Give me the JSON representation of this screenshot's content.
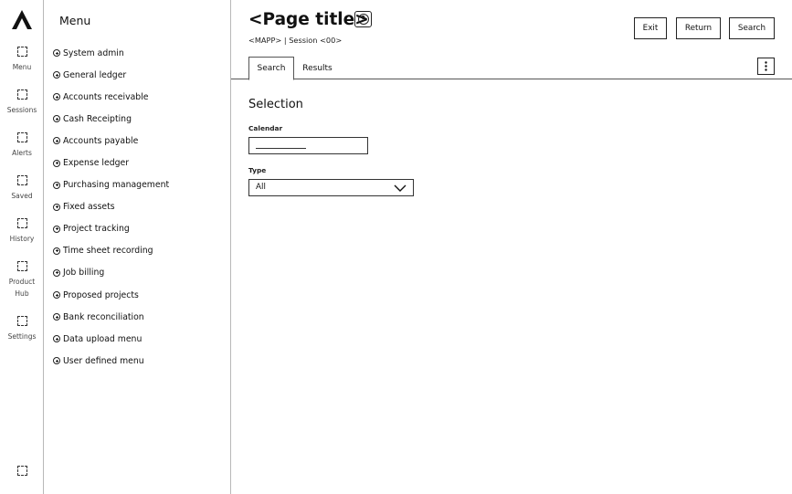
{
  "rail": {
    "items": [
      {
        "label": "Menu",
        "icon": "placeholder-icon"
      },
      {
        "label": "Sessions",
        "icon": "placeholder-icon"
      },
      {
        "label": "Alerts",
        "icon": "placeholder-icon"
      },
      {
        "label": "Saved",
        "icon": "placeholder-icon"
      },
      {
        "label": "History",
        "icon": "placeholder-icon"
      },
      {
        "label": "Product",
        "icon": "placeholder-icon"
      },
      {
        "label": "Hub"
      },
      {
        "label": "Settings",
        "icon": "placeholder-icon"
      }
    ]
  },
  "menu": {
    "title": "Menu",
    "items": [
      {
        "label": "System admin"
      },
      {
        "label": "General ledger"
      },
      {
        "label": "Accounts receivable"
      },
      {
        "label": "Cash Receipting"
      },
      {
        "label": "Accounts payable"
      },
      {
        "label": "Expense ledger"
      },
      {
        "label": "Purchasing management"
      },
      {
        "label": "Fixed assets"
      },
      {
        "label": "Project tracking"
      },
      {
        "label": "Time sheet recording"
      },
      {
        "label": "Job billing"
      },
      {
        "label": "Proposed projects"
      },
      {
        "label": "Bank reconciliation"
      },
      {
        "label": "Data upload menu"
      },
      {
        "label": "User defined menu"
      }
    ]
  },
  "header": {
    "title": "<Page title>",
    "subtitle": "<MAPP> | Session <00>",
    "help_glyph": "?",
    "buttons": {
      "exit": "Exit",
      "return": "Return",
      "search": "Search"
    }
  },
  "tabs": [
    {
      "label": "Search",
      "active": true
    },
    {
      "label": "Results",
      "active": false
    }
  ],
  "form": {
    "section_title": "Selection",
    "calendar": {
      "label": "Calendar"
    },
    "type": {
      "label": "Type",
      "value": "All"
    }
  },
  "colors": {
    "text": "#111111",
    "border": "#b8b8b8",
    "background": "#ffffff"
  }
}
